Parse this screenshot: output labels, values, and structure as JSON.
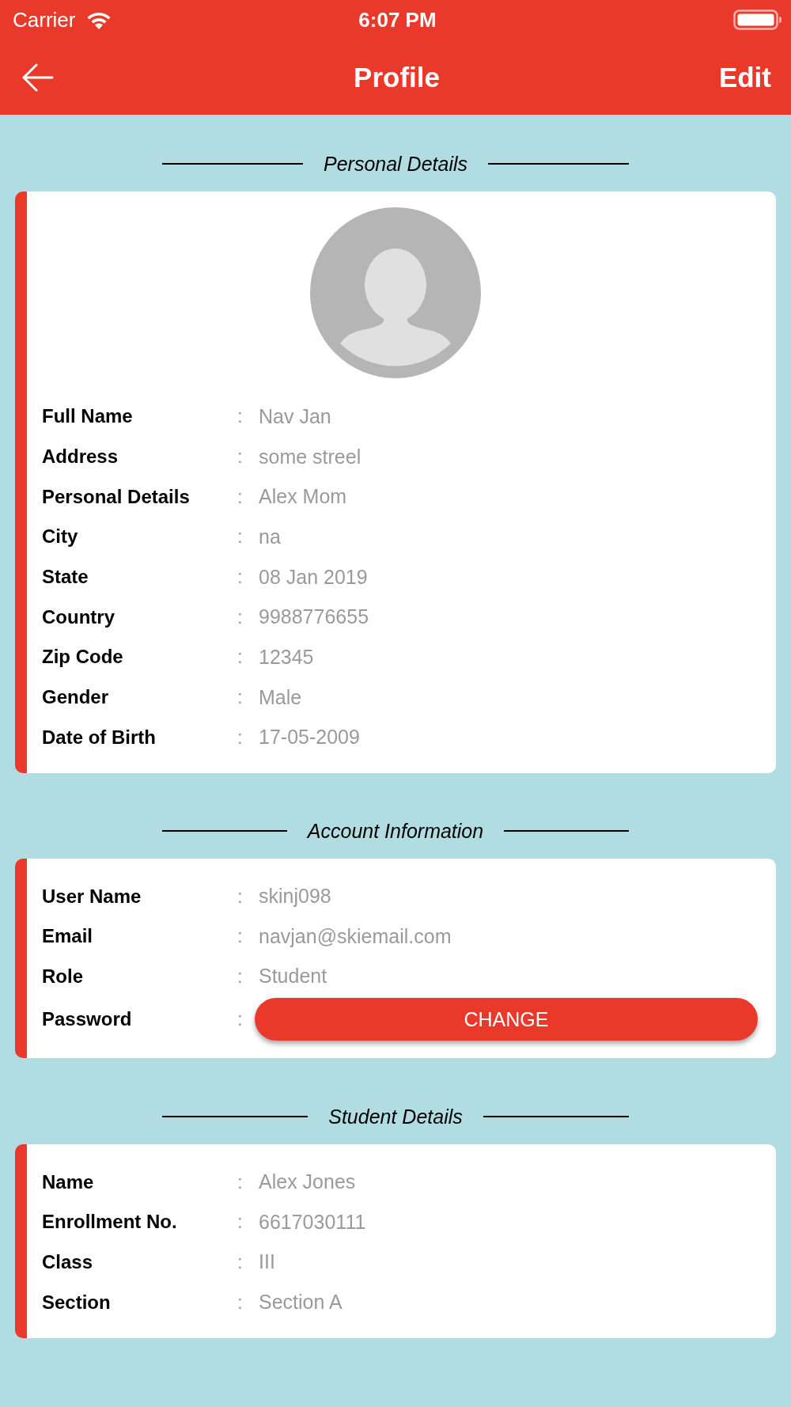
{
  "status_bar": {
    "carrier": "Carrier",
    "time": "6:07 PM"
  },
  "header": {
    "title": "Profile",
    "action": "Edit"
  },
  "sections": [
    {
      "title": "Personal Details",
      "avatar": true,
      "rows": [
        {
          "kind": "text",
          "label": "Full Name",
          "separator": ":",
          "value": "Nav Jan"
        },
        {
          "kind": "text",
          "label": "Address",
          "separator": ":",
          "value": "some streel"
        },
        {
          "kind": "text",
          "label": "Personal Details",
          "separator": ":",
          "value": "Alex Mom"
        },
        {
          "kind": "text",
          "label": "City",
          "separator": ":",
          "value": "na"
        },
        {
          "kind": "text",
          "label": "State",
          "separator": ":",
          "value": "08 Jan 2019"
        },
        {
          "kind": "text",
          "label": "Country",
          "separator": ":",
          "value": "9988776655"
        },
        {
          "kind": "text",
          "label": "Zip Code",
          "separator": ":",
          "value": "12345"
        },
        {
          "kind": "text",
          "label": "Gender",
          "separator": ":",
          "value": "Male"
        },
        {
          "kind": "text",
          "label": "Date of Birth",
          "separator": ":",
          "value": "17-05-2009"
        }
      ]
    },
    {
      "title": "Account Information",
      "rows": [
        {
          "kind": "text",
          "label": "User Name",
          "separator": ":",
          "value": "skinj098"
        },
        {
          "kind": "text",
          "label": "Email",
          "separator": ":",
          "value": "navjan@skiemail.com"
        },
        {
          "kind": "text",
          "label": "Role",
          "separator": ":",
          "value": "Student"
        },
        {
          "kind": "button",
          "label": "Password",
          "separator": ":",
          "button": "CHANGE"
        }
      ]
    },
    {
      "title": "Student Details",
      "rows": [
        {
          "kind": "text",
          "label": "Name",
          "separator": ":",
          "value": "Alex Jones"
        },
        {
          "kind": "text",
          "label": "Enrollment No.",
          "separator": ":",
          "value": "6617030111"
        },
        {
          "kind": "text",
          "label": "Class",
          "separator": ":",
          "value": "III"
        },
        {
          "kind": "text",
          "label": "Section",
          "separator": ":",
          "value": "Section A"
        }
      ]
    }
  ]
}
